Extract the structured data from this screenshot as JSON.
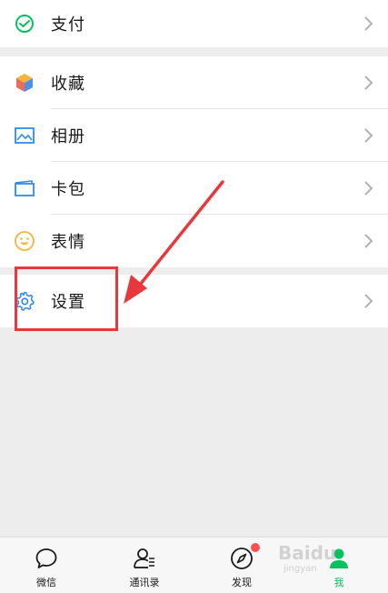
{
  "menu": {
    "pay": {
      "label": "支付",
      "icon": "wechat-pay-icon"
    },
    "favorites": {
      "label": "收藏",
      "icon": "favorites-cube-icon"
    },
    "album": {
      "label": "相册",
      "icon": "album-picture-icon"
    },
    "cards": {
      "label": "卡包",
      "icon": "card-wallet-icon"
    },
    "stickers": {
      "label": "表情",
      "icon": "smiley-icon"
    },
    "settings": {
      "label": "设置",
      "icon": "gear-icon"
    }
  },
  "tabbar": {
    "chats": {
      "label": "微信",
      "icon": "chat-bubble-icon"
    },
    "contacts": {
      "label": "通讯录",
      "icon": "contacts-icon"
    },
    "discover": {
      "label": "发现",
      "icon": "compass-icon",
      "has_badge": true
    },
    "me": {
      "label": "我",
      "icon": "person-icon",
      "active": true
    }
  },
  "watermark": {
    "text": "Baidu",
    "sub": "jingyan"
  },
  "colors": {
    "accent": "#07c160",
    "annotation": "#e8383d",
    "badge": "#fa5151",
    "background": "#ededed"
  }
}
